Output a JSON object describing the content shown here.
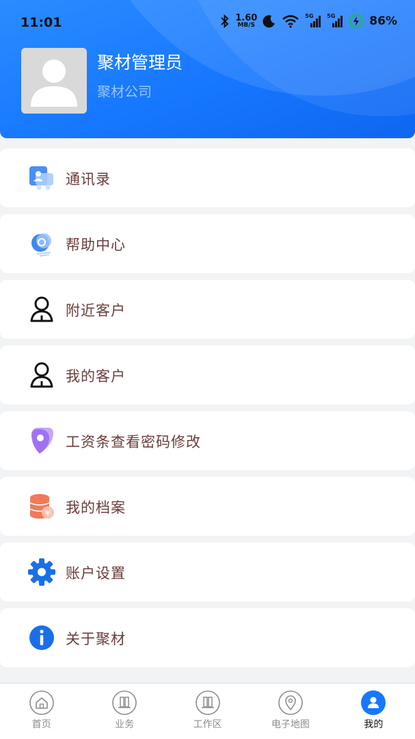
{
  "status": {
    "time": "11:01",
    "net_speed_value": "1.60",
    "net_speed_unit": "MB/S",
    "signal1_label": "5G",
    "signal2_label": "5G",
    "battery": "86%"
  },
  "profile": {
    "name": "聚材管理员",
    "company": "聚材公司"
  },
  "menu": {
    "items": [
      {
        "label": "通讯录",
        "icon": "contacts-icon"
      },
      {
        "label": "帮助中心",
        "icon": "help-center-icon"
      },
      {
        "label": "附近客户",
        "icon": "nearby-customer-icon"
      },
      {
        "label": "我的客户",
        "icon": "my-customer-icon"
      },
      {
        "label": "工资条查看密码修改",
        "icon": "location-pin-icon"
      },
      {
        "label": "我的档案",
        "icon": "database-icon"
      },
      {
        "label": "账户设置",
        "icon": "gear-icon"
      },
      {
        "label": "关于聚材",
        "icon": "info-icon"
      }
    ]
  },
  "tabbar": {
    "items": [
      {
        "label": "首页",
        "icon": "home-icon"
      },
      {
        "label": "业务",
        "icon": "business-icon"
      },
      {
        "label": "工作区",
        "icon": "workspace-icon"
      },
      {
        "label": "电子地图",
        "icon": "map-pin-icon"
      },
      {
        "label": "我的",
        "icon": "profile-icon"
      }
    ],
    "active_index": 4
  },
  "colors": {
    "brand": "#1677ff",
    "menu_text": "#6b3b3b",
    "tab_inactive": "#8c8c8c"
  }
}
